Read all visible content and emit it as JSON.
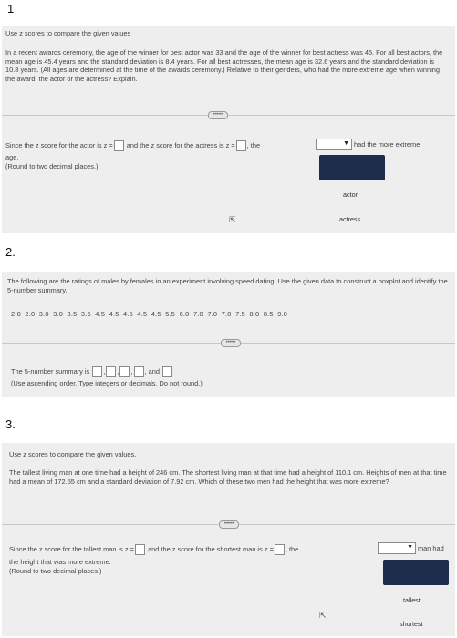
{
  "q1": {
    "number": "1",
    "title": "Use z scores to compare the given values",
    "problem": "In a recent awards ceremony, the age of the winner for best actor was 33 and the age of the winner for best actress was 45. For all best actors, the mean age is 45.4 years and the standard deviation is 8.4 years. For all best actresses, the mean age is 32.6 years and the standard deviation is 10.8 years. (All ages are determined at the time of the awards ceremony.) Relative to their genders, who had the more extreme age when winning the award, the actor or the actress? Explain.",
    "answer_line_a": "Since the z score for the actor is z =",
    "answer_line_b": "and the z score for the actress is z =",
    "answer_line_c": ", the",
    "answer_line_d": "had the more extreme",
    "answer_line_e": "age.",
    "round_note": "(Round to two decimal places.)",
    "options": [
      "actor",
      "actress"
    ]
  },
  "q2": {
    "number": "2.",
    "problem": "The following are the ratings of males by females in an experiment involving speed dating. Use the given data to construct a boxplot and identify the 5-number summary.",
    "data": "2.0  2.0  3.0  3.0  3.5  3.5  4.5  4.5  4.5  4.5  4.5  5.5  6.0  7.0  7.0  7.0  7.5  8.0  8.5  9.0",
    "summary_label": "The 5-number summary is",
    "and_label": "and",
    "note": "(Use ascending order. Type integers or decimals. Do not round.)"
  },
  "q3": {
    "number": "3.",
    "title": "Use z scores to compare the given values.",
    "problem": "The tallest living man at one time had a height of 246 cm. The shortest living man at that time had a height of 110.1 cm. Heights of men at that time had a mean of 172.55 cm and a standard deviation of 7.92 cm. Which of these two men had the height that was more extreme?",
    "answer_line_a": "Since the z score for the tallest man is z =",
    "answer_line_b": "and the z score for the shortest man is z =",
    "answer_line_c": ", the",
    "answer_line_d": "man had",
    "answer_line_e": "the height that was more extreme.",
    "round_note": "(Round to two decimal places.)",
    "options": [
      "tallest",
      "shortest"
    ]
  },
  "more_button": "•••••"
}
